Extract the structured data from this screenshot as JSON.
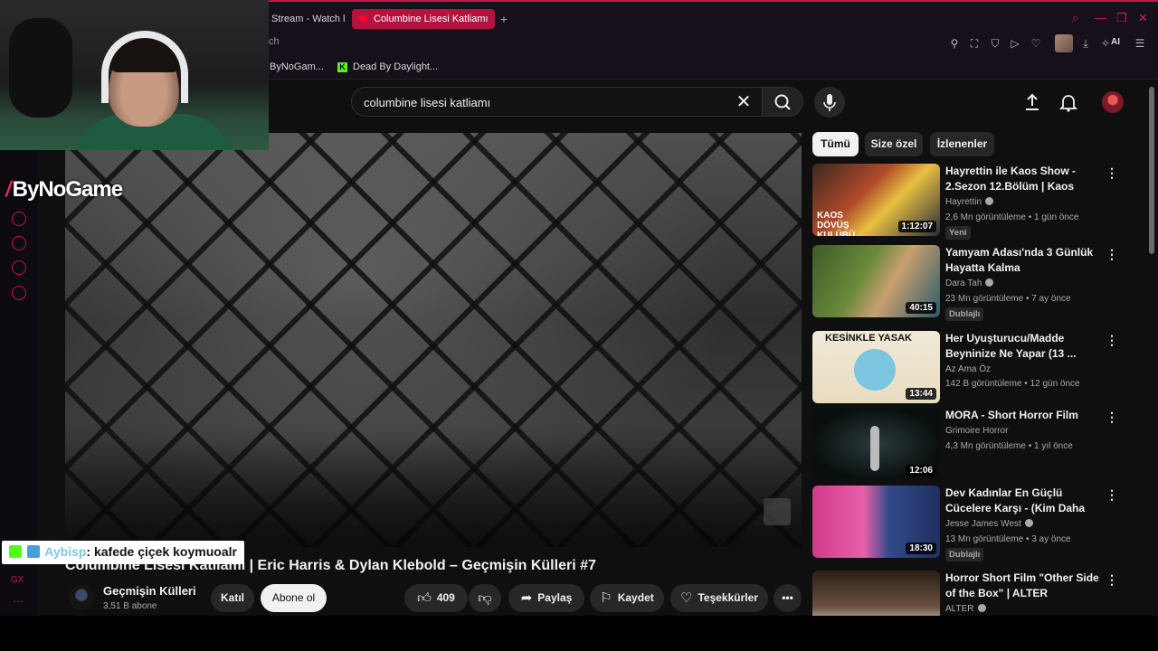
{
  "browser": {
    "tabs": [
      {
        "label": "Stream - Watch l",
        "active": false
      },
      {
        "label": "Columbine Lisesi Katliamı",
        "active": true
      }
    ],
    "new_tab": "+",
    "address_fragment": "ch",
    "ai_label": "AI",
    "bookmarks": [
      "ByNoGam...",
      "Dead By Daylight..."
    ],
    "accent": "#c4184a"
  },
  "youtube": {
    "search": {
      "value": "columbine lisesi katliamı",
      "clear": "✕"
    },
    "video": {
      "title": "Columbine Lisesi Katliamı | Eric Harris & Dylan Klebold – Geçmişin Külleri #7",
      "channel": "Geçmişin Külleri",
      "subscribers": "3,51 B abone",
      "join": "Katıl",
      "subscribe": "Abone ol",
      "likes": "409",
      "share": "Paylaş",
      "save": "Kaydet",
      "thanks": "Teşekkürler"
    },
    "chips": [
      "Tümü",
      "Size özel",
      "İzlenenler"
    ],
    "recommendations": [
      {
        "title": "Hayrettin ile Kaos Show - 2.Sezon 12.Bölüm | Kaos Dövü...",
        "channel": "Hayrettin",
        "meta": "2,6 Mn görüntüleme • 1 gün önce",
        "badge": "Yeni",
        "duration": "1:12:07",
        "thumb_text": "KAOS DÖVÜŞ KULÜBÜ"
      },
      {
        "title": "Yamyam Adası'nda 3 Günlük Hayatta Kalma",
        "channel": "Dara Tah",
        "meta": "23 Mn görüntüleme • 7 ay önce",
        "badge": "Dublajlı",
        "duration": "40:15"
      },
      {
        "title": "Her Uyuşturucu/Madde Beyninize Ne Yapar (13 ...",
        "channel": "Az Ama Öz",
        "meta": "142 B görüntüleme • 12 gün önce",
        "badge": "",
        "duration": "13:44",
        "thumb_text": "KESİNKLE YASAK"
      },
      {
        "title": "MORA - Short Horror Film",
        "channel": "Grimoire Horror",
        "meta": "4,3 Mn görüntüleme • 1 yıl önce",
        "badge": "",
        "duration": "12:06"
      },
      {
        "title": "Dev Kadınlar En Güçlü Cücelere Karşı - (Kim Daha Güçlü?)",
        "channel": "Jesse James West",
        "meta": "13 Mn görüntüleme • 3 ay önce",
        "badge": "Dublajlı",
        "duration": "18:30"
      },
      {
        "title": "Horror Short Film \"Other Side of the Box\" | ALTER",
        "channel": "ALTER",
        "meta": "",
        "badge": "",
        "duration": ""
      }
    ]
  },
  "stream": {
    "brand": "ByNoGame",
    "chat": {
      "user": "Aybisp",
      "message": ": kafede çiçek koymuoalr"
    }
  }
}
